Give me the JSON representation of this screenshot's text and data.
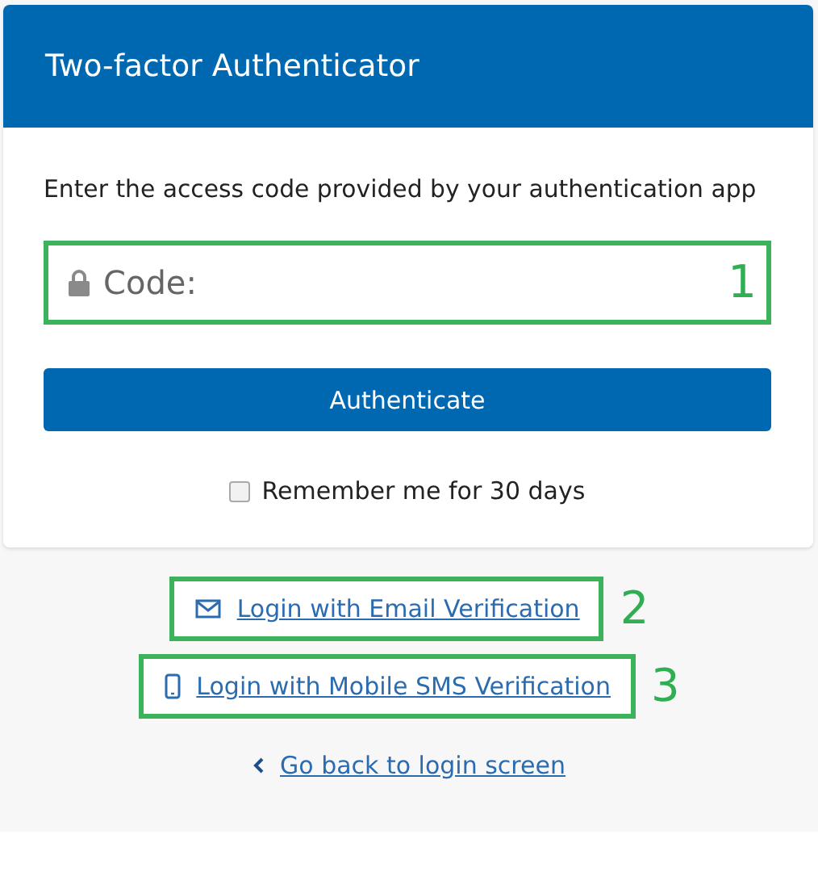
{
  "header": {
    "title": "Two-factor Authenticator"
  },
  "instruction": "Enter the access code provided by your authentication app",
  "code_field": {
    "placeholder": "Code:",
    "annotation": "1"
  },
  "submit_button": "Authenticate",
  "remember": {
    "label": "Remember me for 30 days",
    "checked": false
  },
  "links": [
    {
      "kind": "email",
      "label": "Login with Email Verification",
      "annotation": "2"
    },
    {
      "kind": "sms",
      "label": "Login with Mobile SMS Verification",
      "annotation": "3"
    },
    {
      "kind": "back",
      "label": "Go back to login screen"
    }
  ]
}
